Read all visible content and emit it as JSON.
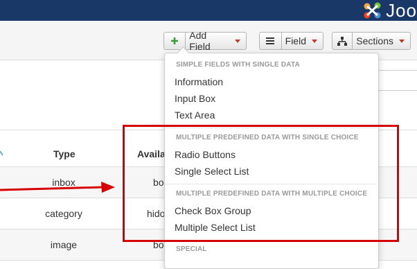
{
  "brand": {
    "logo_text": "Joo"
  },
  "toolbar": {
    "add_field_label": "Add Field",
    "field_label": "Field",
    "sections_label": "Sections"
  },
  "table": {
    "headers": [
      "Type",
      "Availa"
    ],
    "rows": [
      {
        "type": "inbox",
        "avail": "bo"
      },
      {
        "type": "category",
        "avail": "hido"
      },
      {
        "type": "image",
        "avail": "bo"
      }
    ]
  },
  "dropdown": {
    "groups": [
      {
        "header": "SIMPLE FIELDS WITH SINGLE DATA",
        "items": [
          "Information",
          "Input Box",
          "Text Area"
        ]
      },
      {
        "header": "MULTIPLE PREDEFINED DATA WITH SINGLE CHOICE",
        "items": [
          "Radio Buttons",
          "Single Select List"
        ]
      },
      {
        "header": "MULTIPLE PREDEFINED DATA WITH MULTIPLE CHOICE",
        "items": [
          "Check Box Group",
          "Multiple Select List"
        ]
      },
      {
        "header": "SPECIAL",
        "items": []
      }
    ]
  },
  "colors": {
    "accent_red": "#d60000",
    "topbar": "#1a3867",
    "plus_green": "#3c9a3c"
  }
}
